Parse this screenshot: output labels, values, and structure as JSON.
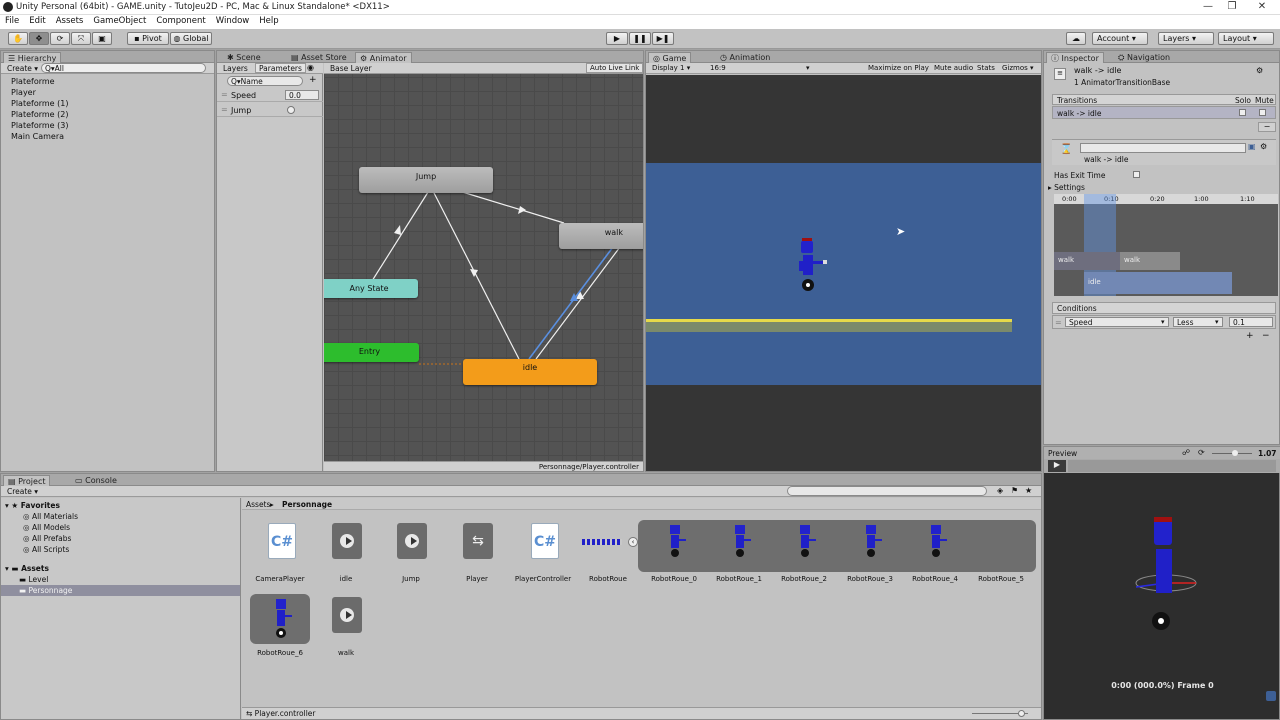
{
  "window": {
    "title": "Unity Personal (64bit) - GAME.unity - TutoJeu2D - PC, Mac & Linux Standalone* <DX11>"
  },
  "menu": [
    "File",
    "Edit",
    "Assets",
    "GameObject",
    "Component",
    "Window",
    "Help"
  ],
  "toolbar": {
    "pivot": "Pivot",
    "global": "Global",
    "account": "Account",
    "layers": "Layers",
    "layout": "Layout"
  },
  "hierarchy": {
    "tab": "Hierarchy",
    "create": "Create",
    "search_placeholder": "Q▾All",
    "items": [
      "Plateforme",
      "Player",
      "Plateforme (1)",
      "Plateforme (2)",
      "Plateforme (3)",
      "Main Camera"
    ]
  },
  "animator": {
    "tabs": [
      "Scene",
      "Asset Store",
      "Animator"
    ],
    "layers_tab": "Layers",
    "parameters_tab": "Parameters",
    "search_placeholder": "Q▾Name",
    "params": [
      {
        "name": "Speed",
        "value": "0.0"
      },
      {
        "name": "Jump",
        "value": ""
      }
    ],
    "base_layer": "Base Layer",
    "auto_live_link": "Auto Live Link",
    "nodes": {
      "jump": "Jump",
      "walk": "walk",
      "any_state": "Any State",
      "entry": "Entry",
      "idle": "idle"
    },
    "footer": "Personnage/Player.controller"
  },
  "game": {
    "tabs": [
      "Game",
      "Animation"
    ],
    "display": "Display 1",
    "aspect": "16:9",
    "buttons": [
      "Maximize on Play",
      "Mute audio",
      "Stats",
      "Gizmos"
    ]
  },
  "inspector": {
    "tabs": [
      "Inspector",
      "Navigation"
    ],
    "title": "walk -> idle",
    "subtitle": "1 AnimatorTransitionBase",
    "transitions_label": "Transitions",
    "solo": "Solo",
    "mute": "Mute",
    "transition_item": "walk -> idle",
    "transition_name": "walk -> idle",
    "has_exit_time": "Has Exit Time",
    "settings": "Settings",
    "timeline_ticks": [
      "0:00",
      "0:10",
      "0:20",
      "1:00",
      "1:10"
    ],
    "timeline_clips": [
      "walk",
      "walk",
      "idle"
    ],
    "conditions_label": "Conditions",
    "condition": {
      "param": "Speed",
      "op": "Less",
      "value": "0.1"
    }
  },
  "preview": {
    "label": "Preview",
    "speed": "1.07",
    "status": "0:00 (000.0%) Frame 0"
  },
  "project": {
    "tabs": [
      "Project",
      "Console"
    ],
    "create": "Create",
    "favorites_label": "Favorites",
    "favorites": [
      "All Materials",
      "All Models",
      "All Prefabs",
      "All Scripts"
    ],
    "assets_label": "Assets",
    "assets_tree": [
      "Level",
      "Personnage"
    ],
    "breadcrumb_root": "Assets",
    "breadcrumb_leaf": "Personnage",
    "items_row1": [
      "CameraPlayer",
      "idle",
      "Jump",
      "Player",
      "PlayerController",
      "RobotRoue"
    ],
    "sprites": [
      "RobotRoue_0",
      "RobotRoue_1",
      "RobotRoue_2",
      "RobotRoue_3",
      "RobotRoue_4",
      "RobotRoue_5"
    ],
    "items_row2": [
      "RobotRoue_6",
      "walk"
    ],
    "footer": "Player.controller"
  },
  "colors": {
    "accent_blue": "#3d5f95",
    "idle_orange": "#f39c1a",
    "entry_green": "#2dbd2d",
    "anystate_teal": "#7fd1c6",
    "platform_yellow": "#e6d94a"
  }
}
